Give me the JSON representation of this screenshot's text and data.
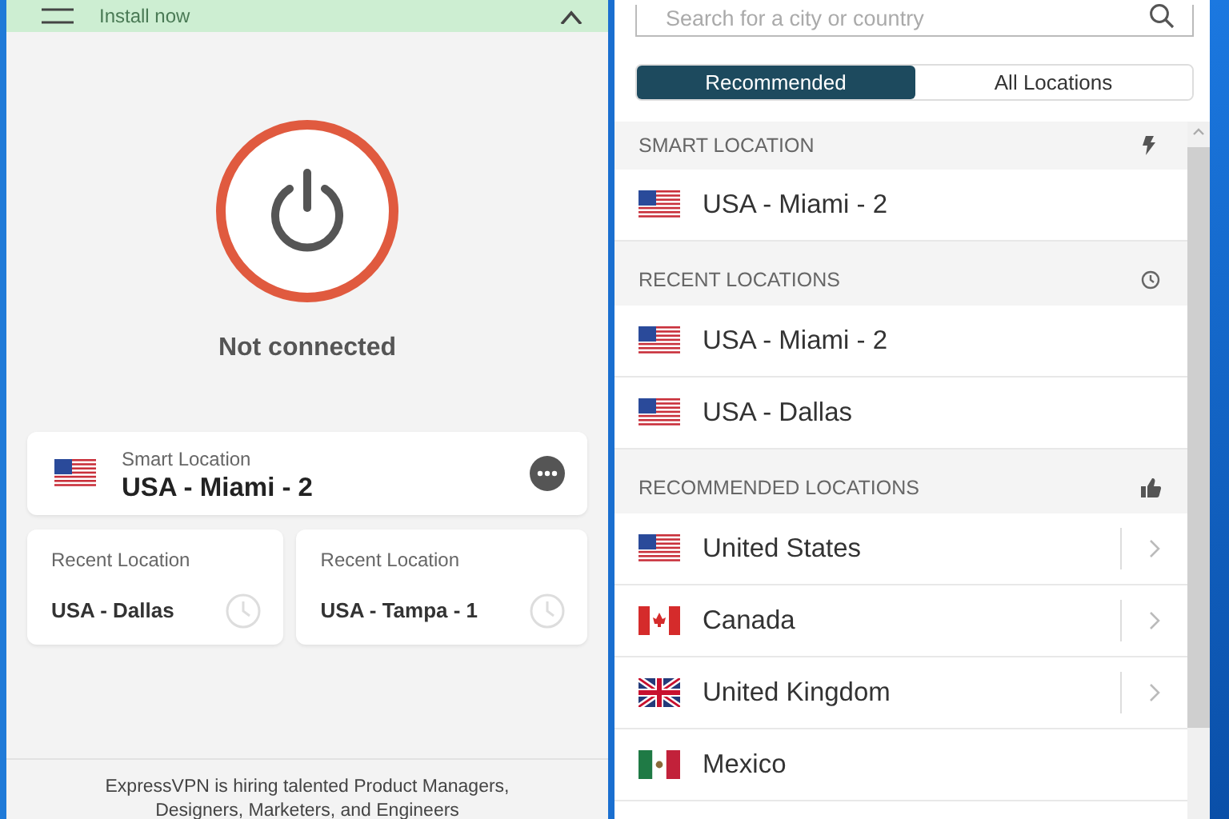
{
  "banner": {
    "action": "Install now"
  },
  "status": "Not connected",
  "smart_location": {
    "label": "Smart Location",
    "name": "USA - Miami - 2",
    "kind": "us"
  },
  "recent_cards": [
    {
      "label": "Recent Location",
      "name": "USA - Dallas"
    },
    {
      "label": "Recent Location",
      "name": "USA - Tampa - 1"
    }
  ],
  "footer": {
    "lines": [
      "ExpressVPN is hiring talented Product Managers,",
      "Designers, Marketers, and Engineers"
    ]
  },
  "search": {
    "placeholder": "Search for a city or country"
  },
  "tabs": [
    {
      "label": "Recommended",
      "selected": true
    },
    {
      "label": "All Locations",
      "selected": false
    }
  ],
  "sections": [
    {
      "title": "SMART LOCATION",
      "kind": "bolt",
      "rows": [
        {
          "name": "USA - Miami - 2",
          "kind": "us",
          "expandable": false
        }
      ]
    },
    {
      "title": "RECENT LOCATIONS",
      "kind": "clock",
      "rows": [
        {
          "name": "USA - Miami - 2",
          "kind": "us",
          "expandable": false
        },
        {
          "name": "USA - Dallas",
          "kind": "us",
          "expandable": false
        }
      ]
    },
    {
      "title": "RECOMMENDED LOCATIONS",
      "kind": "thumb",
      "rows": [
        {
          "name": "United States",
          "kind": "us",
          "expandable": true
        },
        {
          "name": "Canada",
          "kind": "ca",
          "expandable": true
        },
        {
          "name": "United Kingdom",
          "kind": "gb",
          "expandable": true
        },
        {
          "name": "Mexico",
          "kind": "mx",
          "expandable": false
        }
      ]
    }
  ]
}
